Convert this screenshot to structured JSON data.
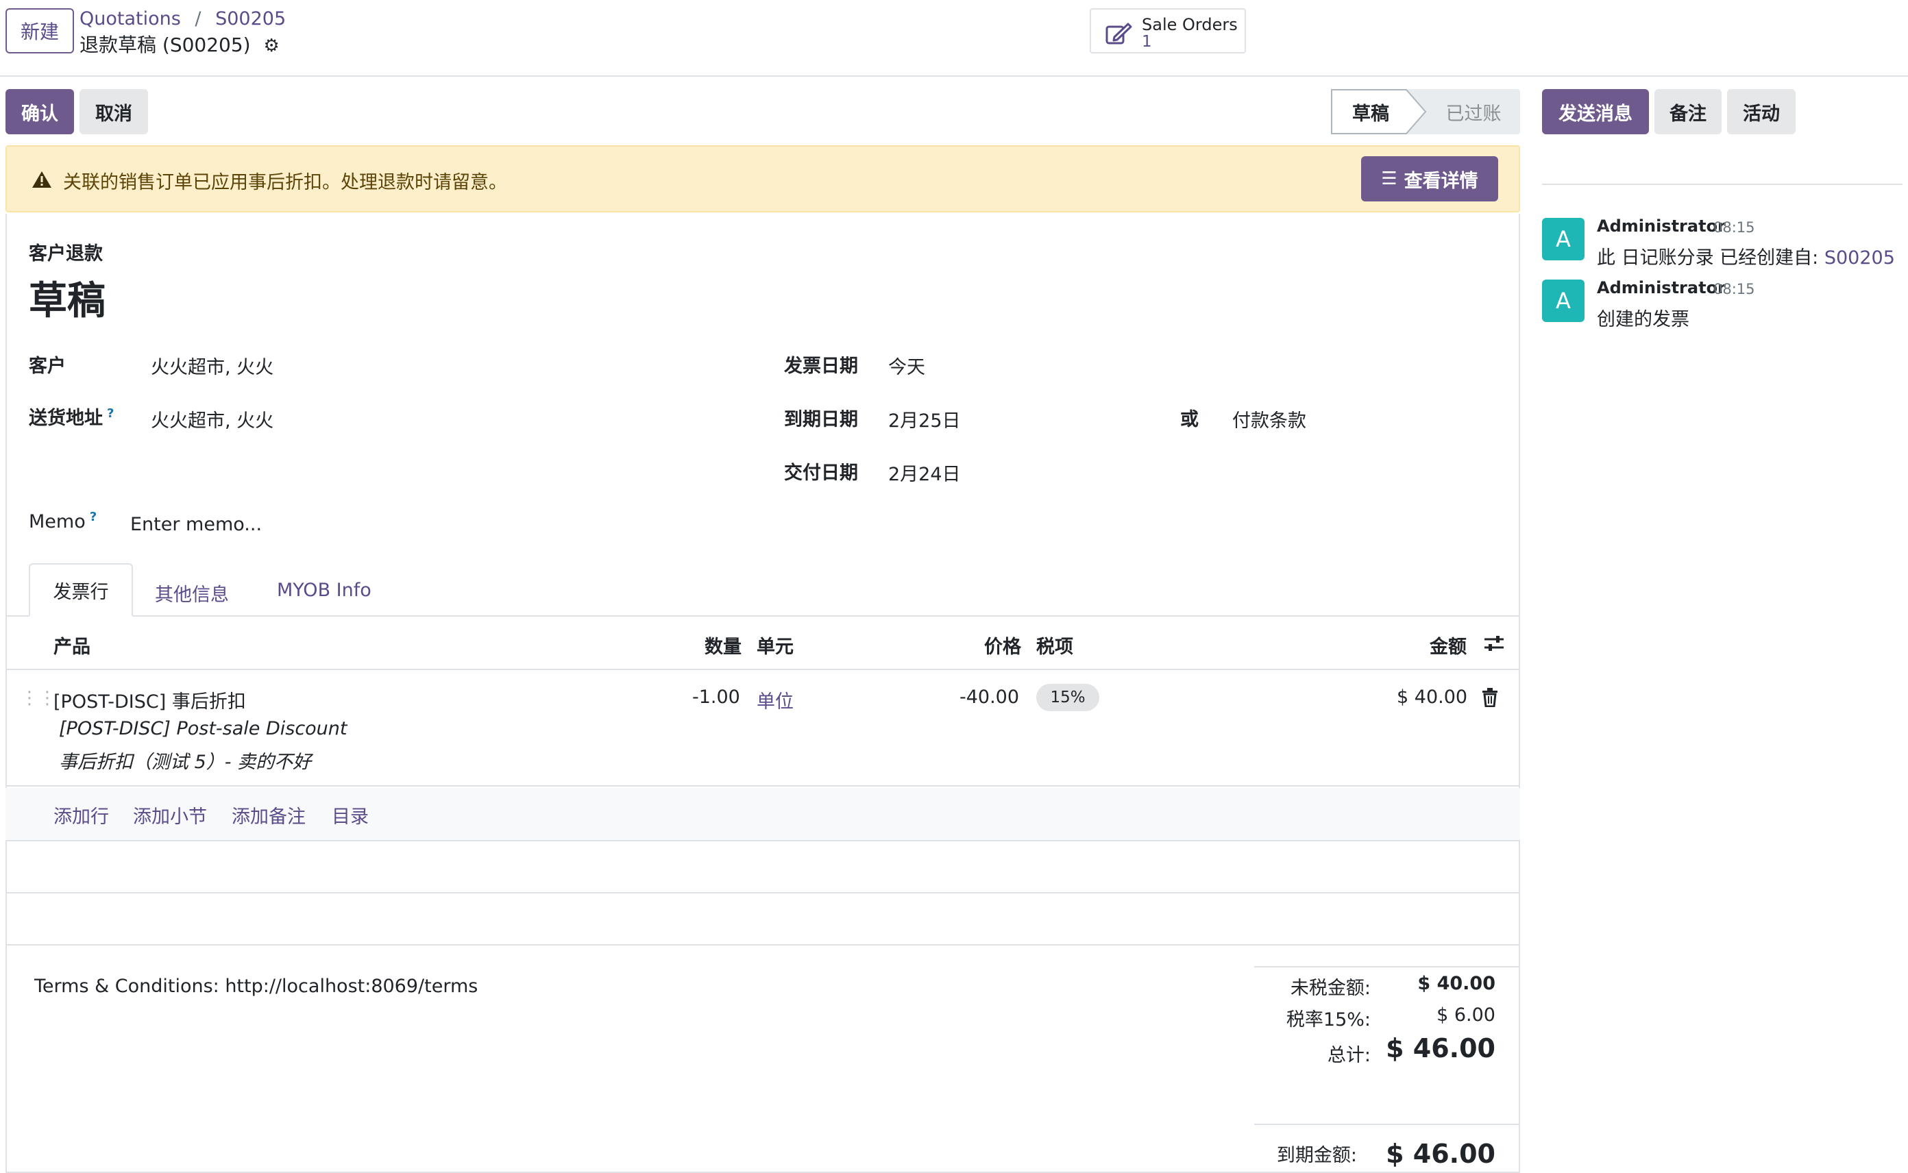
{
  "header": {
    "new_button": "新建",
    "breadcrumb_root": "Quotations",
    "breadcrumb_sep": "/",
    "breadcrumb_current": "S00205",
    "record_title": "退款草稿 (S00205)",
    "smart_button": {
      "label": "Sale Orders",
      "count": "1",
      "icon": "edit-icon"
    }
  },
  "actions": {
    "confirm": "确认",
    "cancel": "取消",
    "status": [
      "草稿",
      "已过账"
    ]
  },
  "chatter_actions": {
    "send_message": "发送消息",
    "log_note": "备注",
    "activity": "活动"
  },
  "alert": {
    "text": "关联的销售订单已应用事后折扣。处理退款时请留意。",
    "button": "查看详情",
    "color": "#fdefc9"
  },
  "form": {
    "doc_type": "客户退款",
    "state_title": "草稿",
    "customer_label": "客户",
    "customer_value": "火火超市, 火火",
    "delivery_label": "送货地址",
    "delivery_tip": "?",
    "delivery_value": "火火超市, 火火",
    "invoice_date_label": "发票日期",
    "invoice_date_placeholder": "今天",
    "due_date_label": "到期日期",
    "due_date_value": "2月25日",
    "or_label": "或",
    "payment_terms_placeholder": "付款条款",
    "delivery_date_label": "交付日期",
    "delivery_date_value": "2月24日",
    "memo_label": "Memo",
    "memo_tip": "?",
    "memo_placeholder": "Enter memo..."
  },
  "tabs": [
    "发票行",
    "其他信息",
    "MYOB Info"
  ],
  "lines_table": {
    "columns": {
      "product": "产品",
      "quantity": "数量",
      "unit": "单元",
      "price": "价格",
      "taxes": "税项",
      "amount": "金额"
    },
    "rows": [
      {
        "product": "[POST-DISC] 事后折扣",
        "description_1": "[POST-DISC] Post-sale Discount",
        "description_2": "事后折扣（测试 5）- 卖的不好",
        "quantity": "-1.00",
        "unit": "单位",
        "price": "-40.00",
        "tax": "15%",
        "amount": "$ 40.00"
      }
    ],
    "add_links": [
      "添加行",
      "添加小节",
      "添加备注",
      "目录"
    ]
  },
  "footer": {
    "terms": "Terms & Conditions: http://localhost:8069/terms",
    "untaxed_label": "未税金额:",
    "untaxed_value": "$ 40.00",
    "tax_label": "税率15%:",
    "tax_value": "$ 6.00",
    "total_label": "总计:",
    "total_value": "$ 46.00",
    "amount_due_label": "到期金额:",
    "amount_due_value": "$ 46.00"
  },
  "chatter": {
    "messages": [
      {
        "author": "Administrator",
        "time": "08:15",
        "avatar": "A",
        "body": "此 日记账分录 已经创建自: ",
        "link": "S00205"
      },
      {
        "author": "Administrator",
        "time": "08:15",
        "avatar": "A",
        "body": "创建的发票",
        "link": ""
      }
    ]
  },
  "colors": {
    "primary": "#6f5a8e",
    "link": "#5b4b8a",
    "alert_bg": "#fdefc9",
    "avatar": "#1fb7b5"
  }
}
